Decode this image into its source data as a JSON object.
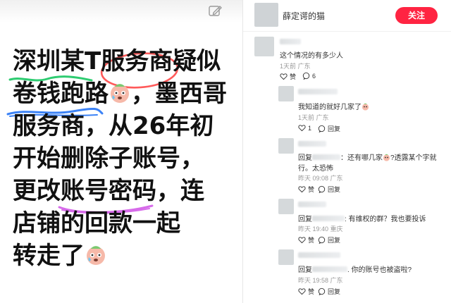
{
  "post": {
    "lines": [
      "深圳某T服务商疑似",
      "卷钱跑路",
      "，墨西哥",
      "服务商，从26年初",
      "开始删除子账号，",
      "更改账号密码，连",
      "店铺的回款一起",
      "转走了"
    ]
  },
  "author": {
    "name": "薛定谔的猫",
    "follow_label": "关注"
  },
  "comments": [
    {
      "text": "这个情况的有多少人",
      "meta": "1天前 广东",
      "like_label": "赞",
      "reply_count": "6"
    },
    {
      "text": "我知道的就好几家了",
      "meta": "1天前 广东",
      "like_count": "1",
      "reply_label": "回复"
    },
    {
      "prefix": "回复",
      "text_a": "：还有哪几家",
      "text_b": "?透露某个字就",
      "text_c": "行。太恐怖",
      "meta": "昨天 09:08 广东",
      "like_label": "赞",
      "reply_label": "回复"
    },
    {
      "prefix": "回复",
      "text": ": 有维权的群？我也要投诉",
      "meta": "昨天 19:40 重庆",
      "like_label": "赞",
      "reply_label": "回复"
    },
    {
      "prefix": "回复",
      "text": ". 你的账号也被盗啦?",
      "meta": "昨天 19:58 广东",
      "like_label": "赞",
      "reply_label": "回复"
    }
  ],
  "colors": {
    "follow": "#ff2442",
    "underline_green": "#2ecc71",
    "circle_red": "#ff5a5a",
    "underline_blue": "#3b82f6",
    "underline_purple": "#d76bea"
  },
  "icons": [
    "edit-icon",
    "emoji-icon",
    "heart-icon",
    "comment-icon"
  ]
}
